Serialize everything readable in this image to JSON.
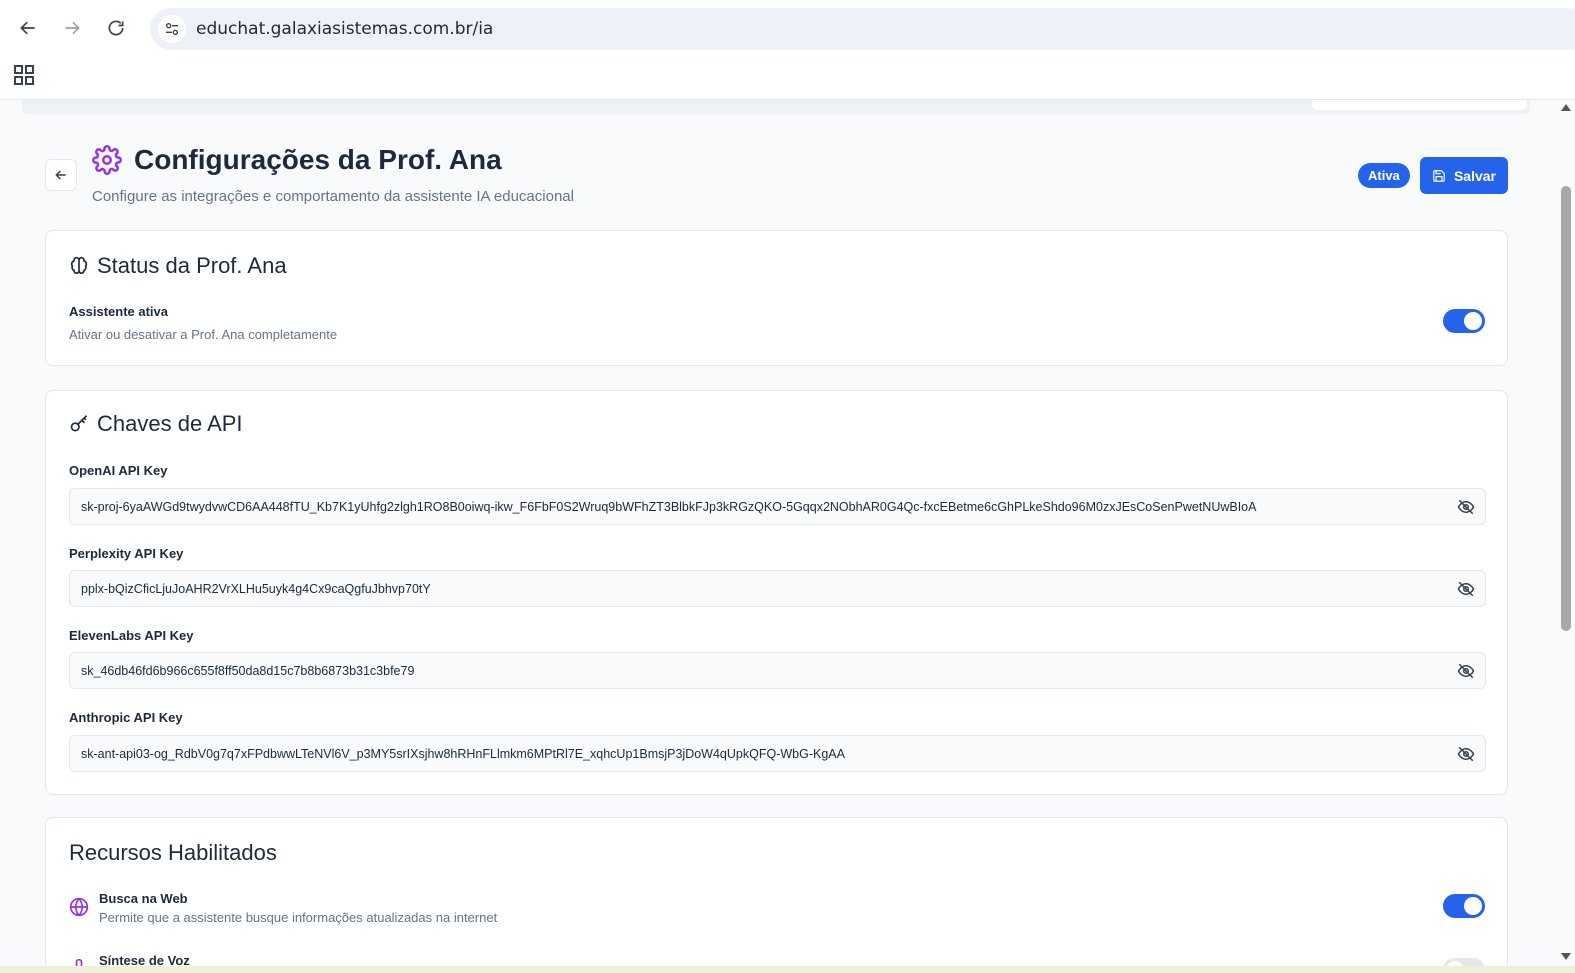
{
  "browser": {
    "url": "educhat.galaxiasistemas.com.br/ia"
  },
  "header": {
    "title": "Configurações da Prof. Ana",
    "subtitle": "Configure as integrações e comportamento da assistente IA educacional",
    "status_badge": "Ativa",
    "save_label": "Salvar"
  },
  "status_card": {
    "title": "Status da Prof. Ana",
    "toggle_label": "Assistente ativa",
    "toggle_desc": "Ativar ou desativar a Prof. Ana completamente",
    "enabled": true
  },
  "api_card": {
    "title": "Chaves de API",
    "keys": [
      {
        "label": "OpenAI API Key",
        "value": "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"
      },
      {
        "label": "Perplexity API Key",
        "value": "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"
      },
      {
        "label": "ElevenLabs API Key",
        "value": "sk_46db46fd6b966c655f8ff50da8d15c7b8b6873b31c3bfe79"
      },
      {
        "label": "Anthropic API Key",
        "value": "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"
      }
    ]
  },
  "features_card": {
    "title": "Recursos Habilitados",
    "items": [
      {
        "label": "Busca na Web",
        "desc": "Permite que a assistente busque informações atualizadas na internet",
        "enabled": true,
        "icon": "globe-icon"
      },
      {
        "label": "Síntese de Voz",
        "desc": "",
        "enabled": false,
        "icon": "mic-icon"
      }
    ]
  },
  "colors": {
    "primary": "#2563eb",
    "accent_purple": "#9333ea",
    "text_dark": "#1e293b",
    "text_muted": "#64748b"
  }
}
